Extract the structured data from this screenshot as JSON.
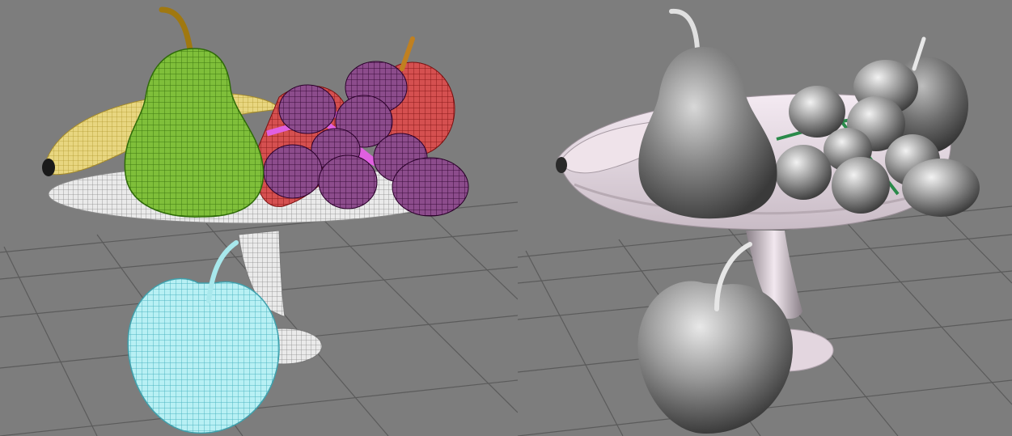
{
  "scene": {
    "background_color": "#7d7d7d",
    "grid_color": "#5e5e5e",
    "viewports": [
      {
        "mode": "wireframe",
        "objects": [
          {
            "name": "banana",
            "color": "#d8c25a"
          },
          {
            "name": "pear",
            "color": "#5fae2e"
          },
          {
            "name": "apple-red",
            "color": "#c83a3a"
          },
          {
            "name": "grapes",
            "color": "#6a2a6a"
          },
          {
            "name": "fruit-bowl-stand",
            "color": "#d9d9d9"
          },
          {
            "name": "apple-front",
            "color": "#8fe0e8"
          }
        ]
      },
      {
        "mode": "shaded",
        "objects": [
          {
            "name": "banana",
            "color": "#e6d8e0"
          },
          {
            "name": "pear",
            "color": "#9a9a9a"
          },
          {
            "name": "apple-back",
            "color": "#8a8a8a"
          },
          {
            "name": "grapes",
            "color": "#a8a8a8"
          },
          {
            "name": "fruit-bowl-stand",
            "color": "#e8dde5"
          },
          {
            "name": "apple-front",
            "color": "#b5b5b5"
          }
        ]
      }
    ]
  }
}
